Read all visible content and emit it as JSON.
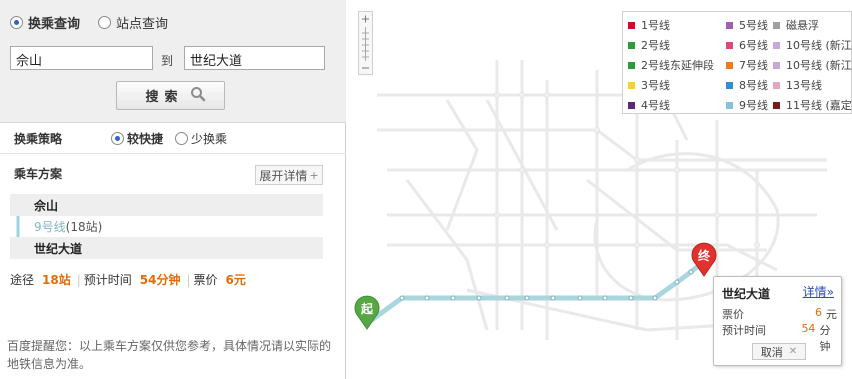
{
  "search": {
    "mode_transfer": "换乘查询",
    "mode_station": "站点查询",
    "from_value": "佘山",
    "to_label": "到",
    "to_value": "世纪大道",
    "search_label": "搜索"
  },
  "strategy": {
    "title": "换乘策略",
    "fast": "较快捷",
    "less_transfer": "少换乘"
  },
  "plan": {
    "title": "乘车方案",
    "expand": "展开详情",
    "start": "佘山",
    "line": "9号线",
    "stations": "(18站)",
    "end": "世纪大道"
  },
  "summary": {
    "via_label": "途径",
    "via_value": "18站",
    "time_label": "预计时间",
    "time_value": "54分钟",
    "price_label": "票价",
    "price_value": "6元"
  },
  "tip": "百度提醒您：以上乘车方案仅供您参考，具体情况请以实际的地铁信息为准。",
  "legend": [
    {
      "label": "1号线",
      "color": "#c8102e"
    },
    {
      "label": "5号线",
      "color": "#a05eb5"
    },
    {
      "label": "磁悬浮",
      "color": "#a0a0a0"
    },
    {
      "label": "2号线",
      "color": "#2a9d3a"
    },
    {
      "label": "6号线",
      "color": "#e0467c"
    },
    {
      "label": "10号线 (新江",
      "color": "#c7a8d8"
    },
    {
      "label": "2号线东延伸段",
      "color": "#2a9d3a"
    },
    {
      "label": "7号线",
      "color": "#ef7d16"
    },
    {
      "label": "10号线 (新江",
      "color": "#c7a8d8"
    },
    {
      "label": "3号线",
      "color": "#f2d22e"
    },
    {
      "label": "8号线",
      "color": "#2f8fd0"
    },
    {
      "label": "13号线",
      "color": "#e4a5c9"
    },
    {
      "label": "4号线",
      "color": "#5a2a7a"
    },
    {
      "label": "9号线",
      "color": "#86c4d1"
    },
    {
      "label": "11号线 (嘉定",
      "color": "#7a1a1a"
    }
  ],
  "markers": {
    "start": "起",
    "end": "终"
  },
  "popup": {
    "title": "世纪大道",
    "detail": "详情»",
    "price_label": "票价",
    "price_value": "6",
    "price_unit": "元",
    "time_label": "预计时间",
    "time_value": "54",
    "time_unit": "分钟",
    "cancel": "取消"
  }
}
